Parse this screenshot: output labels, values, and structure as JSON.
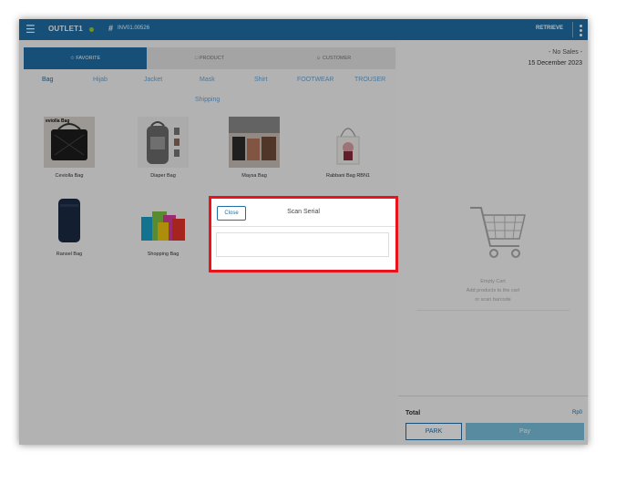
{
  "topbar": {
    "outlet": "OUTLET1",
    "hash": "#",
    "invoice": "INV01.00526",
    "retrieve": "RETRIEVE"
  },
  "tabs": [
    {
      "label": "FAVORITE",
      "icon": "star-icon"
    },
    {
      "label": "PRODUCT",
      "icon": "box-icon"
    },
    {
      "label": "CUSTOMER",
      "icon": "person-icon"
    }
  ],
  "categories": [
    "Bag",
    "Hijab",
    "Jacket",
    "Mask",
    "Shirt",
    "FOOTWEAR",
    "TROUSER",
    "Shipping"
  ],
  "products": [
    {
      "name": "Ceviolla Bag",
      "thumb_label": "eviolla Bag"
    },
    {
      "name": "Diaper Bag"
    },
    {
      "name": "Maysa Bag"
    },
    {
      "name": "Rabbani Bag RBN1"
    },
    {
      "name": "Ransel Bag"
    },
    {
      "name": "Shopping Bag"
    }
  ],
  "cart": {
    "sales_status": "- No Sales -",
    "date": "15 December 2023",
    "empty_title": "Empty Cart",
    "empty_line1": "Add products to the cart",
    "empty_line2": "or scan barcode",
    "total_label": "Total",
    "total_value": "Rp0",
    "park": "PARK",
    "pay": "Pay"
  },
  "modal": {
    "close": "Close",
    "title": "Scan Serial",
    "input_value": ""
  },
  "colors": {
    "primary": "#1f6fa8",
    "highlight": "#e8131b",
    "pay_disabled": "#7bc1de"
  }
}
